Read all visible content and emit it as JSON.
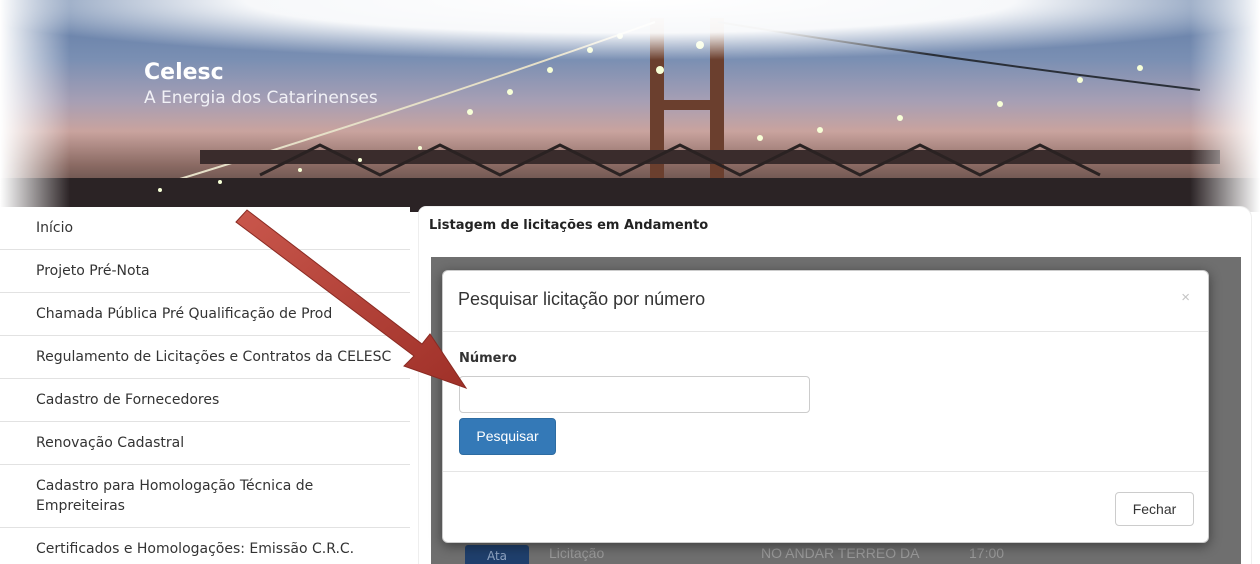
{
  "brand": {
    "title": "Celesc",
    "subtitle": "A Energia dos Catarinenses"
  },
  "sidebar": {
    "items": [
      {
        "label": "Início"
      },
      {
        "label": "Projeto Pré-Nota"
      },
      {
        "label": "Chamada Pública Pré Qualificação de Prod"
      },
      {
        "label": "Regulamento de Licitações e Contratos da CELESC"
      },
      {
        "label": "Cadastro de Fornecedores"
      },
      {
        "label": "Renovação Cadastral"
      },
      {
        "label": "Cadastro para Homologação Técnica de Empreiteiras"
      },
      {
        "label": "Certificados e Homologações: Emissão C.R.C."
      }
    ]
  },
  "main": {
    "title": "Listagem de licitações em Andamento",
    "visible_row": {
      "badge": "Ata",
      "type": "Licitação",
      "location": "NO ANDAR TERREO DA",
      "time": "17:00"
    }
  },
  "modal": {
    "title": "Pesquisar licitação por número",
    "close_symbol": "×",
    "field_label": "Número",
    "field_value": "",
    "field_placeholder": "",
    "search_button": "Pesquisar",
    "close_button": "Fechar"
  },
  "annotation": {
    "arrow_color": "#b8423a",
    "arrow_icon": "red-arrow-icon"
  },
  "colors": {
    "primary_button": "#3479b7",
    "overlay": "#6f6f6f"
  }
}
